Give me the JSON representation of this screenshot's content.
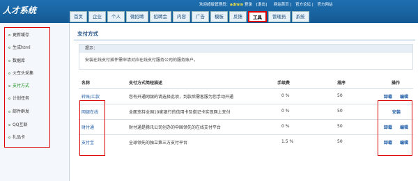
{
  "header": {
    "logo": "人才系统",
    "welcome": "欢迎超级管理员：",
    "user": "admin",
    "logged_in": "登录",
    "logout": "[退出]",
    "links": [
      "网站首页",
      "官方论坛",
      "官方网站"
    ]
  },
  "nav": {
    "tabs": [
      "首页",
      "企业",
      "个人",
      "微招聘",
      "招聘会",
      "内容",
      "广告",
      "模板",
      "反馈",
      "工具",
      "管理员",
      "系统"
    ],
    "active": "工具"
  },
  "sidebar": {
    "items": [
      "更新缓存",
      "生成html",
      "数据库",
      "火车头采集",
      "支付方式",
      "计划任务",
      "邮件群发",
      "QQ互联",
      "礼品卡"
    ],
    "active": "支付方式"
  },
  "main": {
    "title": "支付方式",
    "tip_title": "提示：",
    "tip_text": "安装在线支付插件需申请对应在线支付服务公司的服务账户。",
    "columns": [
      "名称",
      "支付方式简短描述",
      "手续费",
      "排序",
      "操作"
    ],
    "rows": [
      {
        "name": "转账/汇款",
        "desc": "您有开通网银的请选择此项，到款后需客服为您手动开通",
        "fee": "0 %",
        "order": "50",
        "actions": [
          "卸载",
          "编辑"
        ]
      },
      {
        "name": "网银在线",
        "desc": "全面支持全国19家银行的信用卡及借记卡实现网上支付",
        "fee": "0 %",
        "order": "50",
        "actions": [
          "安装"
        ]
      },
      {
        "name": "财付通",
        "desc": "财付通是腾讯公司创办的中国领先的在线支付平台",
        "fee": "0 %",
        "order": "50",
        "actions": [
          "卸载",
          "编辑"
        ]
      },
      {
        "name": "支付宝",
        "desc": "全球领先的独立第三方支付平台",
        "fee": "1.5 %",
        "order": "50",
        "actions": [
          "卸载",
          "编辑"
        ]
      }
    ]
  }
}
